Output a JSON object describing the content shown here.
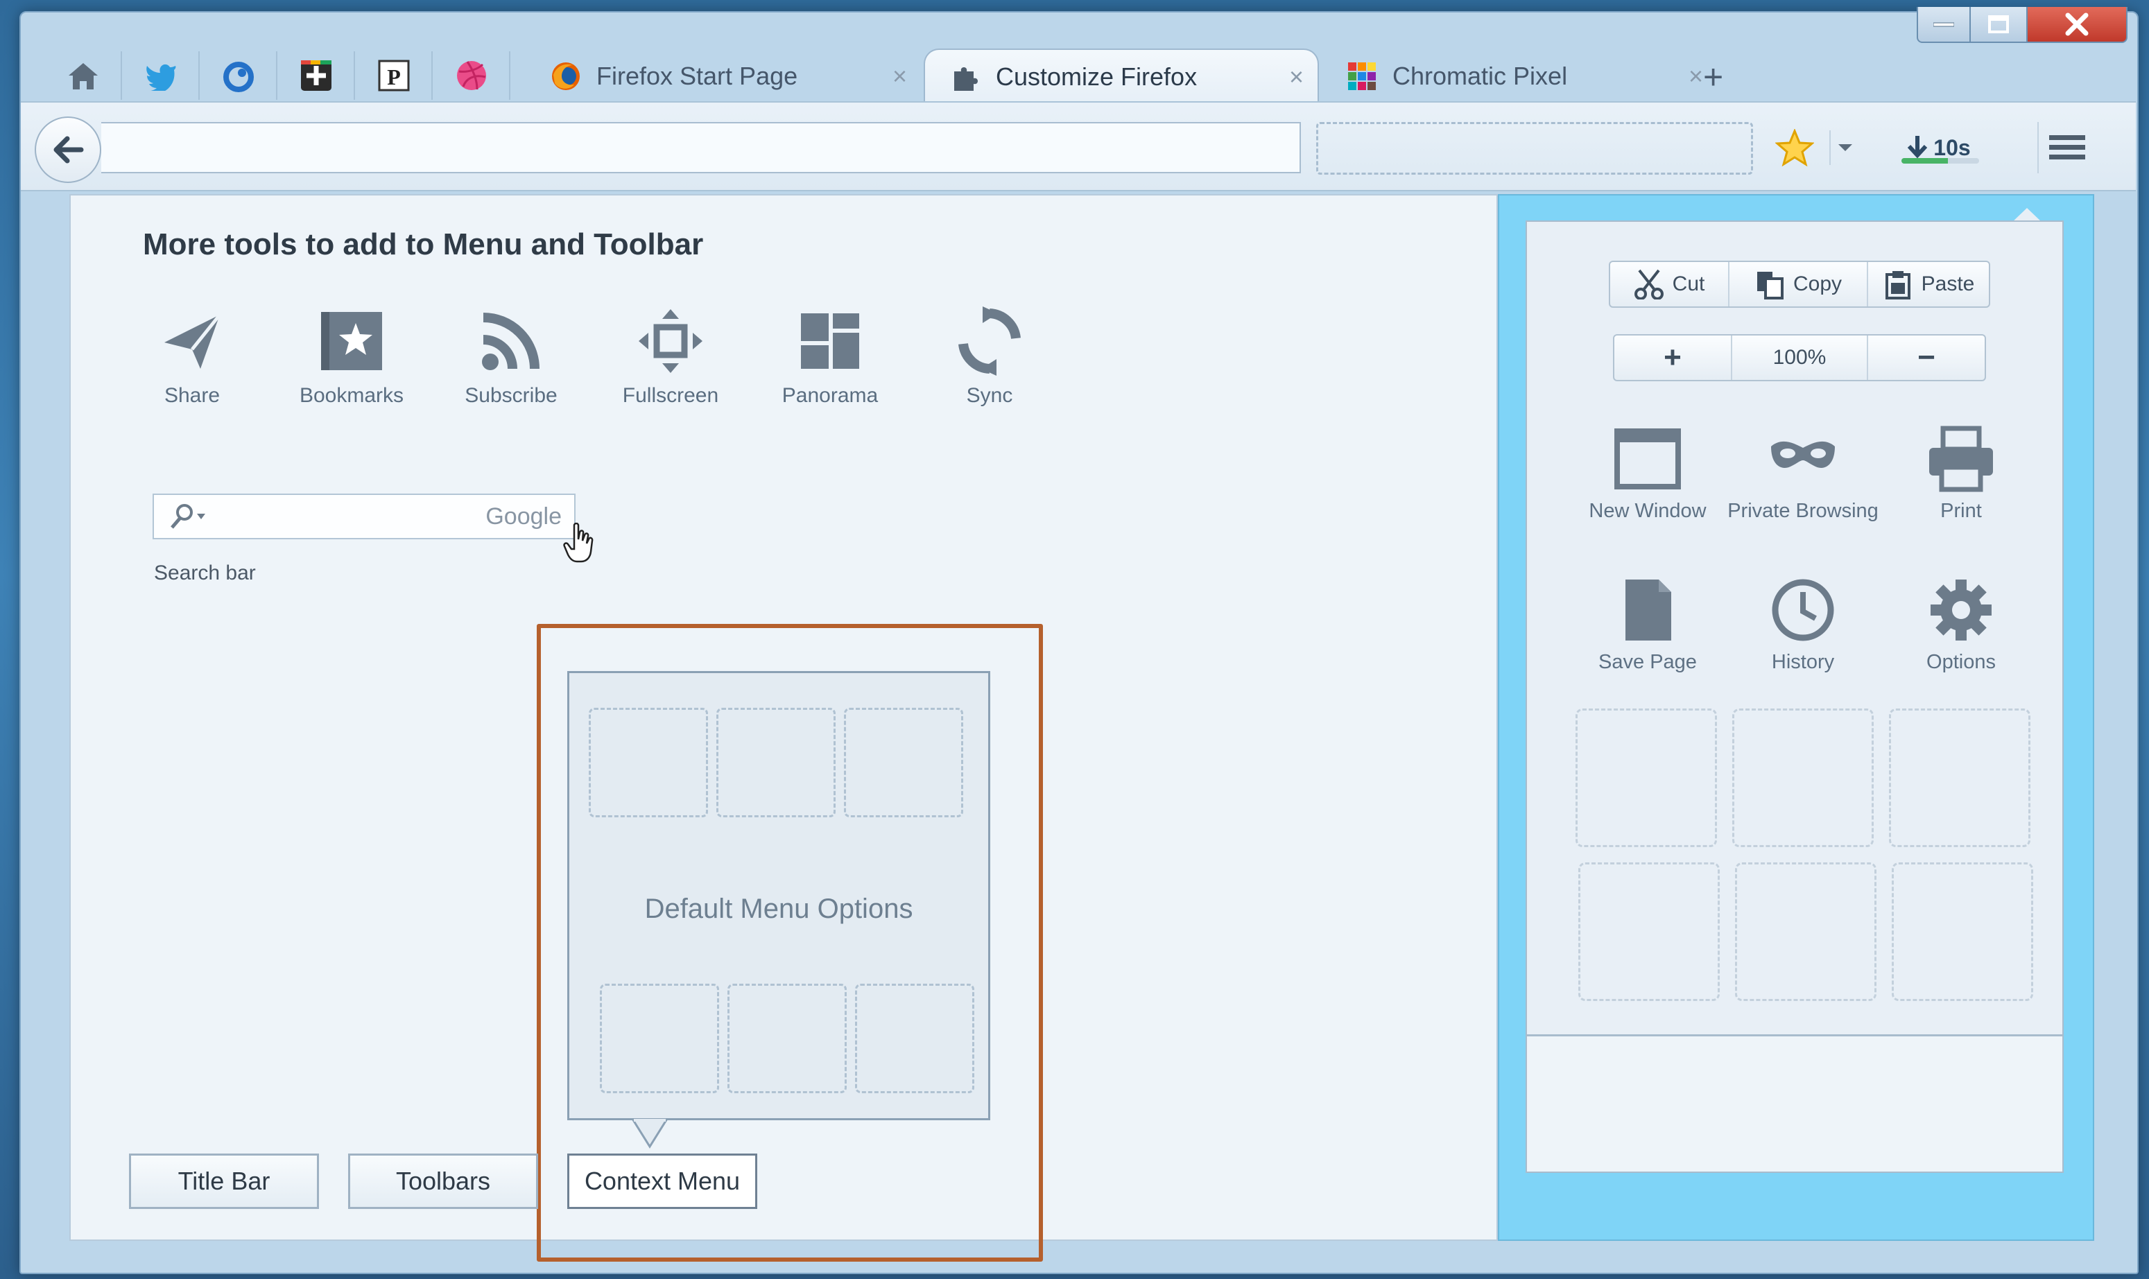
{
  "window": {
    "controls": [
      "minimize",
      "maximize",
      "close"
    ]
  },
  "pinned_tabs": [
    {
      "name": "home-icon"
    },
    {
      "name": "twitter-icon"
    },
    {
      "name": "feed-icon"
    },
    {
      "name": "google-plus-icon"
    },
    {
      "name": "pocket-icon"
    },
    {
      "name": "dribbble-icon"
    }
  ],
  "tabs": [
    {
      "label": "Firefox Start Page",
      "close": "×"
    },
    {
      "label": "Customize Firefox",
      "close": "×"
    },
    {
      "label": "Chromatic Pixel",
      "close": "×"
    }
  ],
  "new_tab_label": "+",
  "navbar": {
    "download_label": "10s",
    "download_progress": 0.6
  },
  "customize": {
    "title": "More tools to add to Menu and Toolbar",
    "tools": [
      {
        "label": "Share",
        "icon": "share-icon"
      },
      {
        "label": "Bookmarks",
        "icon": "bookmarks-icon"
      },
      {
        "label": "Subscribe",
        "icon": "rss-icon"
      },
      {
        "label": "Fullscreen",
        "icon": "fullscreen-icon"
      },
      {
        "label": "Panorama",
        "icon": "panorama-icon"
      },
      {
        "label": "Sync",
        "icon": "sync-icon"
      }
    ],
    "search_engine": "Google",
    "search_label": "Search bar",
    "context_preview_label": "Default Menu Options",
    "bottom_buttons": [
      "Title Bar",
      "Toolbars",
      "Context Menu"
    ]
  },
  "panel": {
    "edit": {
      "cut": "Cut",
      "copy": "Copy",
      "paste": "Paste"
    },
    "zoom": {
      "plus": "+",
      "level": "100%",
      "minus": "−"
    },
    "items": [
      {
        "label": "New Window",
        "icon": "new-window-icon"
      },
      {
        "label": "Private Browsing",
        "icon": "mask-icon"
      },
      {
        "label": "Print",
        "icon": "printer-icon"
      },
      {
        "label": "Save Page",
        "icon": "page-icon"
      },
      {
        "label": "History",
        "icon": "clock-icon"
      },
      {
        "label": "Options",
        "icon": "gear-icon"
      }
    ]
  },
  "colors": {
    "highlight": "#b5602d",
    "panel_accent": "#7fd4f7"
  }
}
